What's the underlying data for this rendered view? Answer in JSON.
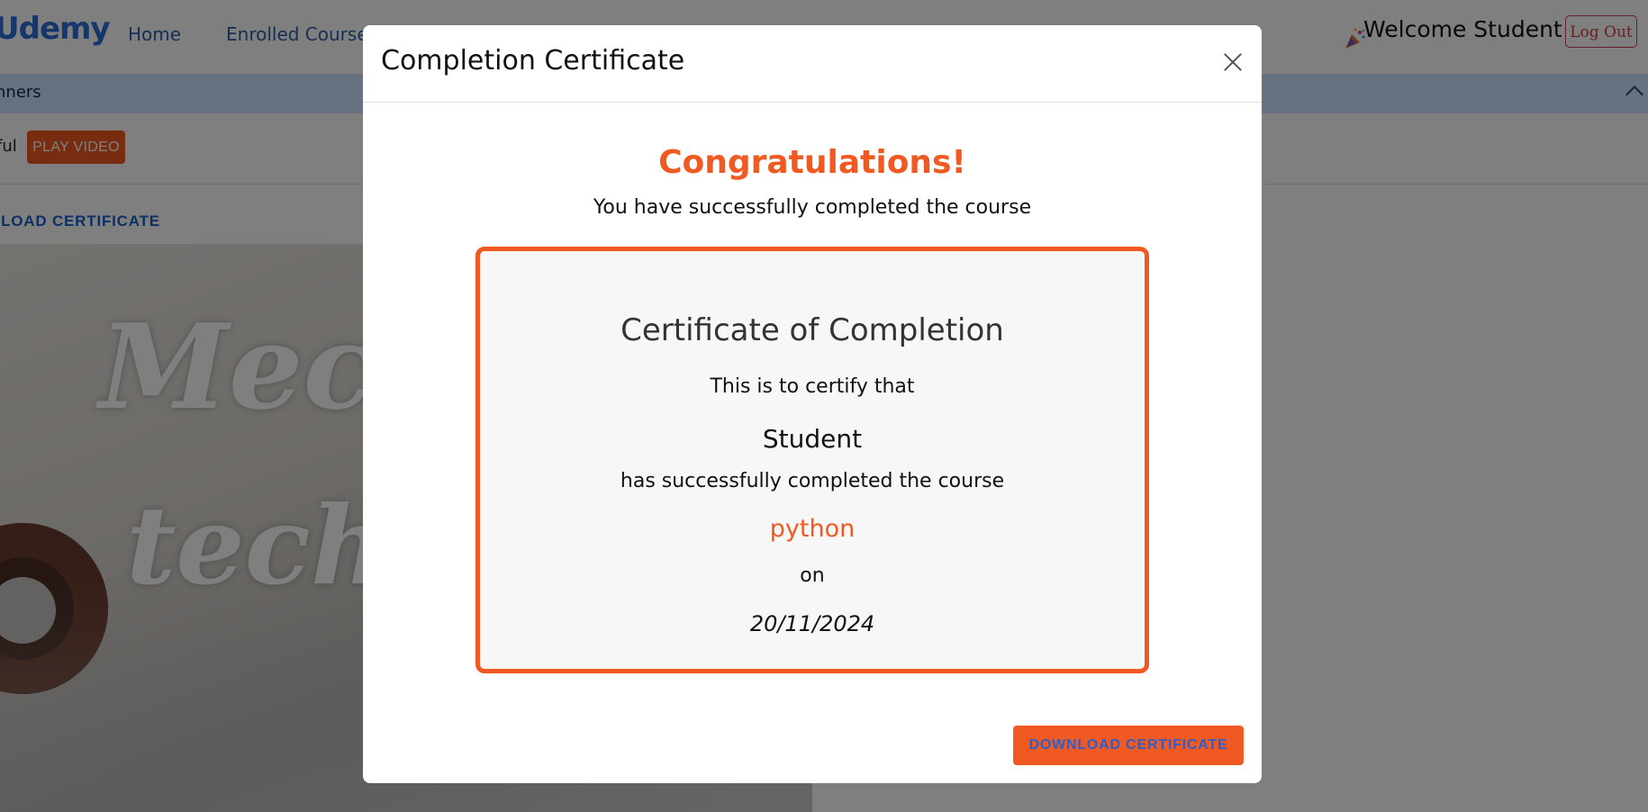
{
  "navbar": {
    "brand": "Udemy",
    "links": [
      "Home",
      "Enrolled Courses"
    ],
    "welcome": "Welcome Student!",
    "logout": "Log Out"
  },
  "course_page": {
    "accordion_title": "inners",
    "lesson_text": "ful",
    "play_video": "PLAY VIDEO",
    "download_certificate": "NLOAD CERTIFICATE",
    "video_words": [
      "Mech",
      "techn"
    ]
  },
  "modal": {
    "title": "Completion Certificate",
    "congrats": "Congratulations!",
    "subline": "You have successfully completed the course",
    "certificate": {
      "title": "Certificate of Completion",
      "certify": "This is to certify that",
      "name": "Student",
      "completed": "has successfully completed the course",
      "course": "python",
      "on": "on",
      "date": "20/11/2024"
    },
    "download_button": "DOWNLOAD CERTIFICATE"
  },
  "icons": {
    "close": "close-icon",
    "party": "party-popper-icon",
    "chevron": "chevron-up-icon"
  },
  "colors": {
    "accent": "#f05a22",
    "link": "#2a5fcf",
    "brand": "#2a6fd6",
    "logout": "#d33a4a",
    "backdrop": "rgba(0,0,0,0.5)"
  }
}
